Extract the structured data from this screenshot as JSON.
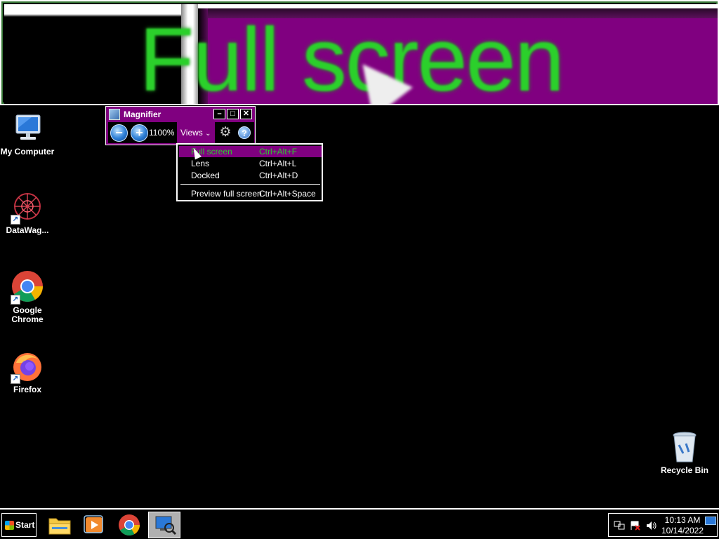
{
  "magnifier_view": {
    "zoomed_text": "Full screen"
  },
  "desktop": {
    "icons": [
      {
        "label": "My Computer"
      },
      {
        "label": "DataWag..."
      },
      {
        "label": "Google\nChrome",
        "label_line1": "Google",
        "label_line2": "Chrome"
      },
      {
        "label": "Firefox"
      },
      {
        "label": "Recycle Bin"
      }
    ]
  },
  "magnifier": {
    "title": "Magnifier",
    "zoom_level": "1100%",
    "views_label": "Views",
    "minimize_glyph": "–",
    "maximize_glyph": "□",
    "close_glyph": "✕",
    "zoom_out_glyph": "−",
    "zoom_in_glyph": "+",
    "help_glyph": "?",
    "options_glyph": "⚙"
  },
  "views_menu": {
    "items": [
      {
        "label": "Full screen",
        "shortcut": "Ctrl+Alt+F",
        "highlighted": true
      },
      {
        "label": "Lens",
        "shortcut": "Ctrl+Alt+L",
        "highlighted": false
      },
      {
        "label": "Docked",
        "shortcut": "Ctrl+Alt+D",
        "highlighted": false
      },
      {
        "label": "Preview full screen",
        "shortcut": "Ctrl+Alt+Space",
        "highlighted": false
      }
    ]
  },
  "taskbar": {
    "start_label": "Start",
    "time": "10:13 AM",
    "date": "10/14/2022"
  },
  "colors": {
    "accent": "#800080",
    "highlight_text": "#2bd02b",
    "background": "#000000"
  }
}
